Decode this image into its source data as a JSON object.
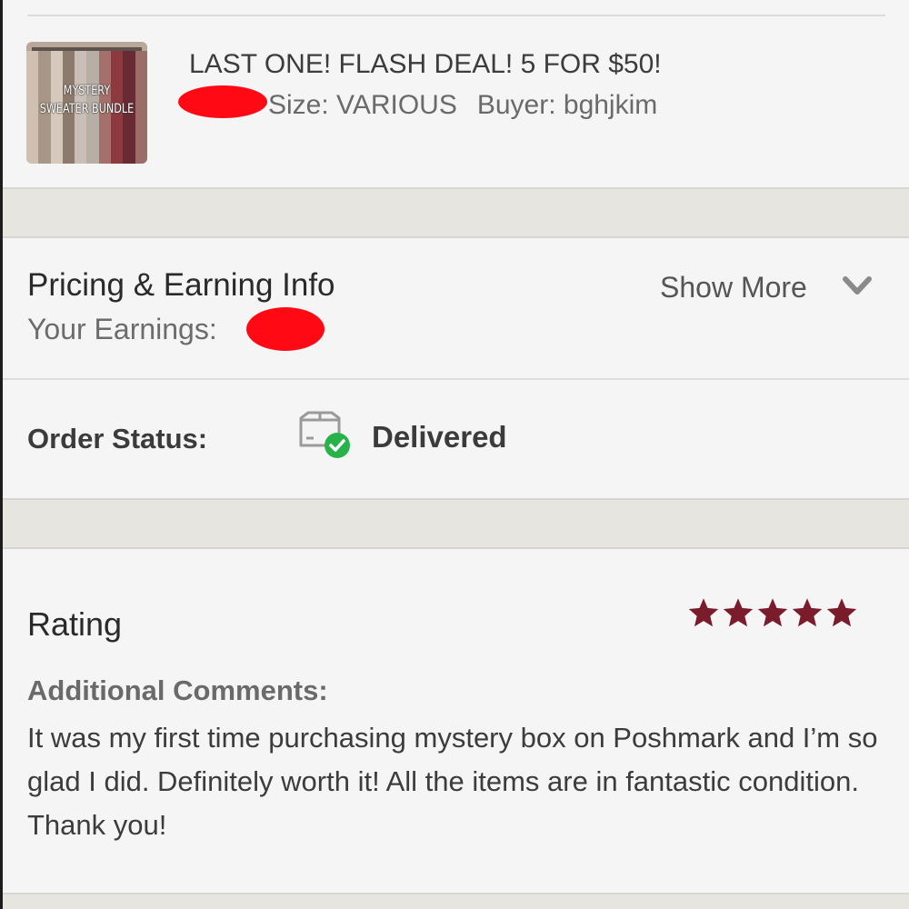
{
  "listing": {
    "thumbnail_text": "MYSTERY SWEATER BUNDLE",
    "title": "LAST ONE! FLASH DEAL! 5 FOR $50!",
    "size": "Size: VARIOUS",
    "buyer": "Buyer: bghjkim"
  },
  "pricing": {
    "title": "Pricing & Earning Info",
    "earnings_label": "Your Earnings:",
    "show_more_label": "Show More"
  },
  "order": {
    "status_label": "Order Status:",
    "status_value": "Delivered"
  },
  "rating": {
    "title": "Rating",
    "stars": 5,
    "max_stars": 5,
    "star_color": "#7b1c2c",
    "comments_label": "Additional Comments:",
    "comments_text": "It was my first time purchasing mystery box on Poshmark and I’m so glad I did. Definitely worth it! All the items are in fantastic condition. Thank you!"
  },
  "colors": {
    "redaction": "#ff0a14",
    "delivered_check": "#27b34a"
  },
  "icons": {
    "status_icon": "delivered-box-icon",
    "expand_icon": "chevron-down-icon",
    "star_icon": "star-icon"
  }
}
